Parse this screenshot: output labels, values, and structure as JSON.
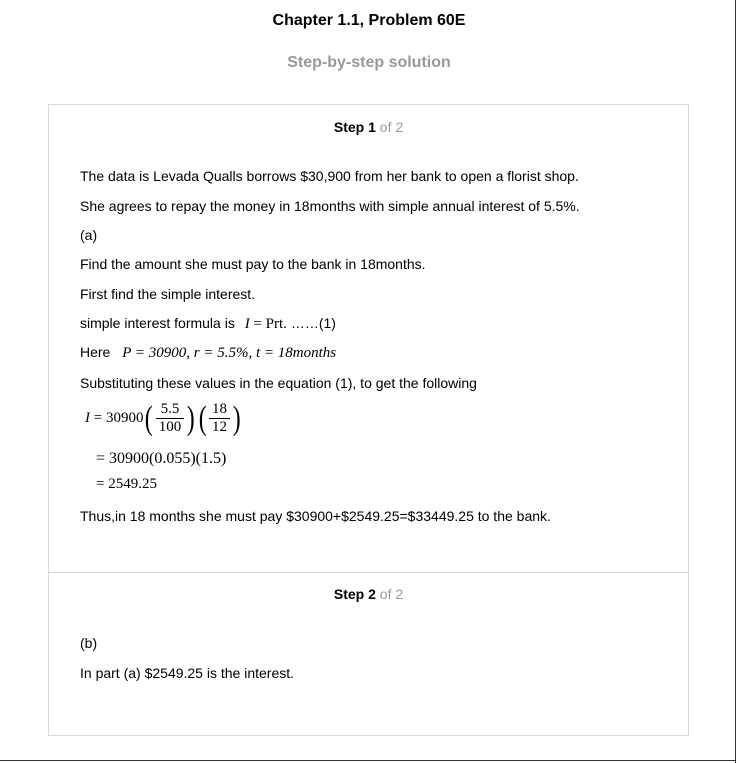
{
  "header": {
    "title": "Chapter 1.1, Problem 60E",
    "subtitle": "Step-by-step solution"
  },
  "step1": {
    "word": "Step",
    "num": "1",
    "of": "of 2",
    "lines": [
      "The data is Levada Qualls borrows $30,900 from her bank to open a florist shop.",
      "She agrees to repay the money in 18months with simple annual interest of 5.5%.",
      "(a)",
      "Find the amount she must pay to the bank in 18months.",
      "First find the simple interest."
    ],
    "formula_label": "simple interest formula is",
    "formula_lhs": "I",
    "formula_rhs": "= Prt.",
    "formula_ref": "……(1)",
    "here_label": "Here",
    "here_expr": "P = 30900, r = 5.5%, t = 18",
    "here_unit": "months",
    "subst_text": "Substituting these values in the equation (1), to get the following",
    "calc_lhs": "I",
    "calc_eq1": "= 30900",
    "frac1_num": "5.5",
    "frac1_den": "100",
    "frac2_num": "18",
    "frac2_den": "12",
    "calc_eq2": "= 30900(0.055)(1.5)",
    "calc_eq3": "= 2549.25",
    "conclusion": "Thus,in 18 months she must pay $30900+$2549.25=$33449.25 to the bank."
  },
  "step2": {
    "word": "Step",
    "num": "2",
    "of": "of 2",
    "part": "(b)",
    "text": "In part (a) $2549.25 is the interest."
  }
}
